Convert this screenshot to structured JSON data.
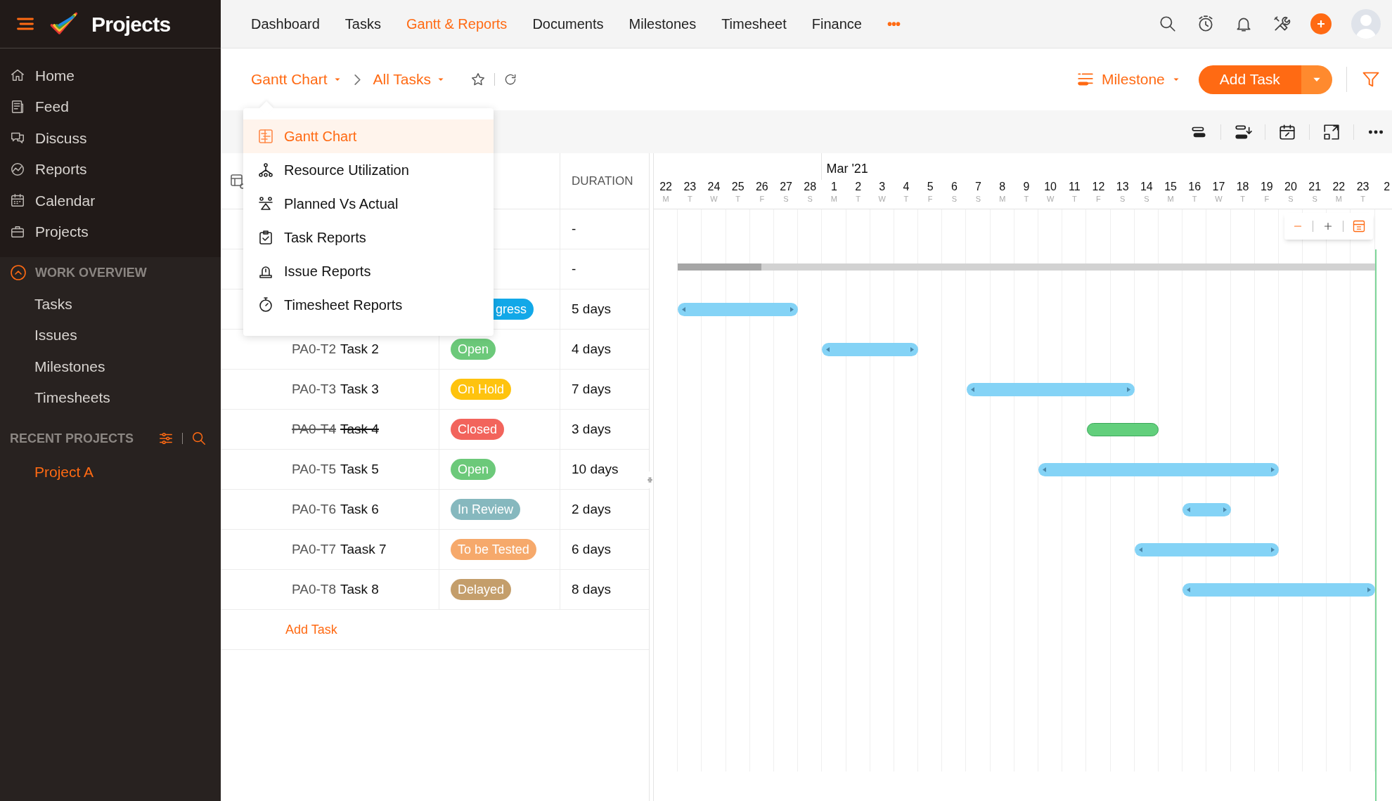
{
  "app": {
    "title": "Projects"
  },
  "sidebar": {
    "items": [
      {
        "label": "Home"
      },
      {
        "label": "Feed"
      },
      {
        "label": "Discuss"
      },
      {
        "label": "Reports"
      },
      {
        "label": "Calendar"
      },
      {
        "label": "Projects"
      }
    ],
    "work_overview": {
      "title": "WORK OVERVIEW",
      "expanded": true,
      "items": [
        {
          "label": "Tasks"
        },
        {
          "label": "Issues"
        },
        {
          "label": "Milestones"
        },
        {
          "label": "Timesheets"
        }
      ]
    },
    "recent_projects": {
      "title": "RECENT PROJECTS",
      "items": [
        {
          "label": "Project A"
        }
      ]
    }
  },
  "top_nav": [
    {
      "label": "Dashboard",
      "selected": false
    },
    {
      "label": "Tasks",
      "selected": false
    },
    {
      "label": "Gantt & Reports",
      "selected": true
    },
    {
      "label": "Documents",
      "selected": false
    },
    {
      "label": "Milestones",
      "selected": false
    },
    {
      "label": "Timesheet",
      "selected": false
    },
    {
      "label": "Finance",
      "selected": false
    }
  ],
  "more": "•••",
  "toolbar": {
    "view": "Gantt Chart",
    "filter": "All Tasks",
    "milestone": "Milestone",
    "add_button": "Add Task"
  },
  "view_menu": [
    {
      "label": "Gantt Chart",
      "selected": true
    },
    {
      "label": "Resource Utilization",
      "selected": false
    },
    {
      "label": "Planned Vs Actual",
      "selected": false
    },
    {
      "label": "Task Reports",
      "selected": false
    },
    {
      "label": "Issue Reports",
      "selected": false
    },
    {
      "label": "Timesheet Reports",
      "selected": false
    }
  ],
  "table": {
    "duration_header": "DURATION",
    "add_task": "Add Task",
    "rows": [
      {
        "kind": "group",
        "duration": "-"
      },
      {
        "kind": "summary",
        "duration": "-",
        "level": 0.12
      },
      {
        "kind": "task",
        "status": {
          "label": "gress",
          "color": "#12a8e8"
        },
        "duration": "5 days",
        "bar": {
          "color": "#84d3f6"
        }
      },
      {
        "kind": "task",
        "id": "PA0-T2",
        "name": "Task 2",
        "status": {
          "label": "Open",
          "color": "#6cc97a"
        },
        "duration": "4 days",
        "struck": false,
        "bar": {
          "color": "#84d3f6"
        }
      },
      {
        "kind": "task",
        "id": "PA0-T3",
        "name": "Task 3",
        "status": {
          "label": "On Hold",
          "color": "#fec30e"
        },
        "duration": "7 days",
        "struck": false,
        "bar": {
          "color": "#84d3f6"
        }
      },
      {
        "kind": "task",
        "id": "PA0-T4",
        "name": "Task 4",
        "status": {
          "label": "Closed",
          "color": "#f2645c"
        },
        "duration": "3 days",
        "struck": true,
        "bar": {
          "color": "#62cf7c"
        }
      },
      {
        "kind": "task",
        "id": "PA0-T5",
        "name": "Task 5",
        "status": {
          "label": "Open",
          "color": "#6cc97a"
        },
        "duration": "10 days",
        "struck": false,
        "bar": {
          "color": "#84d3f6"
        }
      },
      {
        "kind": "task",
        "id": "PA0-T6",
        "name": "Task 6",
        "status": {
          "label": "In Review",
          "color": "#86b8be"
        },
        "duration": "2 days",
        "struck": false,
        "bar": {
          "color": "#84d3f6"
        }
      },
      {
        "kind": "task",
        "id": "PA0-T7",
        "name": "Taask 7",
        "status": {
          "label": "To be Tested",
          "color": "#f6a96b"
        },
        "duration": "6 days",
        "struck": false,
        "bar": {
          "color": "#84d3f6"
        }
      },
      {
        "kind": "task",
        "id": "PA0-T8",
        "name": "Task 8",
        "status": {
          "label": "Delayed",
          "color": "#c49e6b"
        },
        "duration": "8 days",
        "struck": false,
        "bar": {
          "color": "#84d3f6"
        }
      }
    ]
  },
  "gantt": {
    "month": "Mar '21",
    "days": [
      {
        "day": "22",
        "weekday": "M"
      },
      {
        "day": "23",
        "weekday": "T"
      },
      {
        "day": "24",
        "weekday": "W"
      },
      {
        "day": "25",
        "weekday": "T"
      },
      {
        "day": "26",
        "weekday": "F"
      },
      {
        "day": "27",
        "weekday": "S"
      },
      {
        "day": "28",
        "weekday": "S"
      },
      {
        "day": "1",
        "weekday": "M"
      },
      {
        "day": "2",
        "weekday": "T"
      },
      {
        "day": "3",
        "weekday": "W"
      },
      {
        "day": "4",
        "weekday": "T"
      },
      {
        "day": "5",
        "weekday": "F"
      },
      {
        "day": "6",
        "weekday": "S"
      },
      {
        "day": "7",
        "weekday": "S"
      },
      {
        "day": "8",
        "weekday": "M"
      },
      {
        "day": "9",
        "weekday": "T"
      },
      {
        "day": "10",
        "weekday": "W"
      },
      {
        "day": "11",
        "weekday": "T"
      },
      {
        "day": "12",
        "weekday": "F"
      },
      {
        "day": "13",
        "weekday": "S"
      },
      {
        "day": "14",
        "weekday": "S"
      },
      {
        "day": "15",
        "weekday": "M"
      },
      {
        "day": "16",
        "weekday": "T"
      },
      {
        "day": "17",
        "weekday": "W"
      },
      {
        "day": "18",
        "weekday": "T"
      },
      {
        "day": "19",
        "weekday": "F"
      },
      {
        "day": "20",
        "weekday": "S"
      },
      {
        "day": "21",
        "weekday": "S"
      },
      {
        "day": "22",
        "weekday": "M"
      },
      {
        "day": "23",
        "weekday": "T"
      },
      {
        "day": "2"
      }
    ]
  }
}
